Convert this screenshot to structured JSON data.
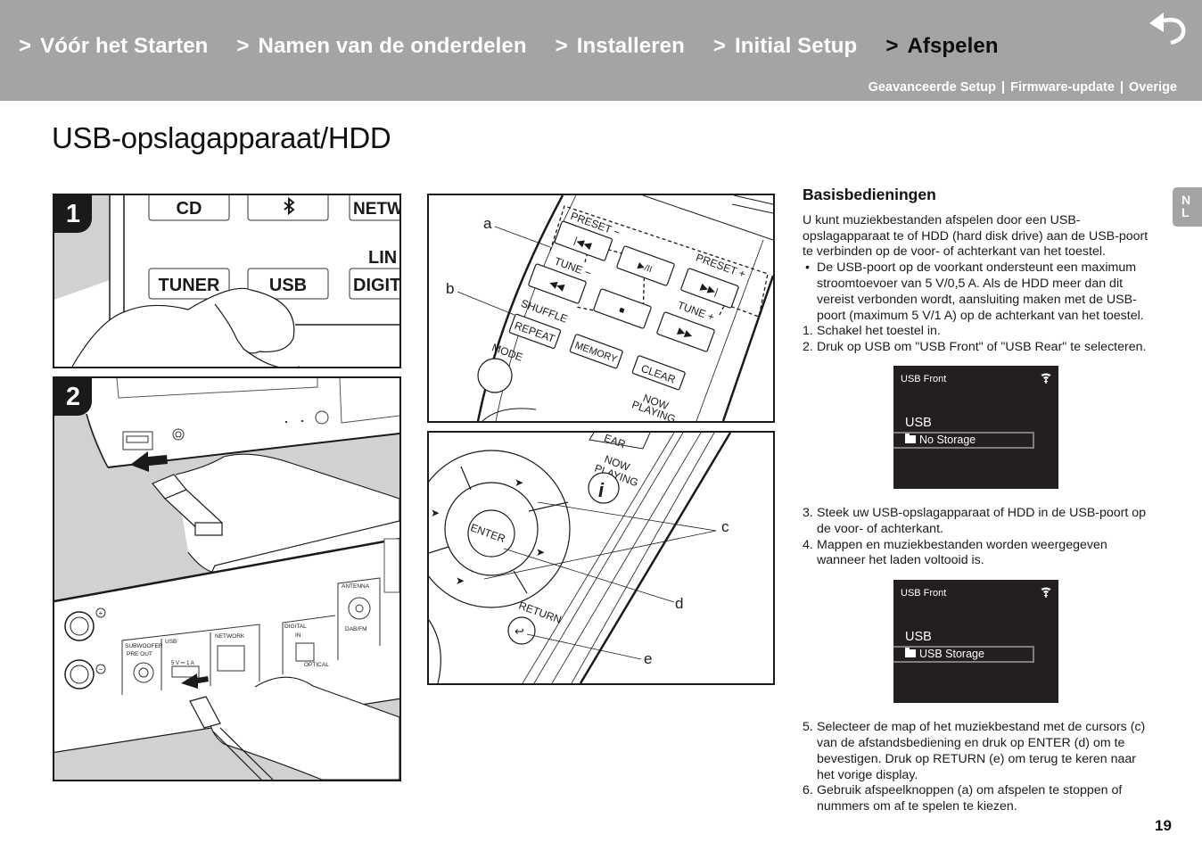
{
  "header": {
    "nav": [
      {
        "label": "Vóór het Starten",
        "active": false
      },
      {
        "label": "Namen van de onderdelen",
        "active": false
      },
      {
        "label": "Installeren",
        "active": false
      },
      {
        "label": "Initial Setup",
        "active": false
      },
      {
        "label": "Afspelen",
        "active": true
      }
    ],
    "chevron": ">",
    "back_icon": "return-arrow-icon",
    "subnav": [
      "Geavanceerde Setup",
      "Firmware-update",
      "Overige"
    ],
    "subnav_separator": "|",
    "colors": {
      "bar": "#a5a3a4",
      "text": "#ffffff",
      "active": "#0d0d0d"
    }
  },
  "page": {
    "title": "USB-opslagapparaat/HDD",
    "language_badge": [
      "N",
      "L"
    ],
    "page_number": "19"
  },
  "figures": {
    "panel1": {
      "step": "1",
      "buttons": [
        "CD",
        "NETWO",
        "TUNER",
        "USB",
        "DIGIT"
      ],
      "side_label": "LIN",
      "bluetooth_icon": "bluetooth-icon"
    },
    "panel2": {
      "step": "2",
      "rear_labels": {
        "subwoofer": "SUBWOOFER",
        "pre_out": "PRE OUT",
        "usb": "USB",
        "usb_rating": "5 V ⎓ 1 A",
        "network": "NETWORK",
        "digital": "DIGITAL",
        "in": "IN",
        "optical": "OPTICAL",
        "antenna": "ANTENNA",
        "dab_fm": "DAB/FM",
        "plus": "+",
        "minus": "−"
      }
    },
    "panel3": {
      "callouts": [
        "a",
        "b"
      ],
      "buttons": {
        "preset_minus": "PRESET −",
        "preset_plus": "PRESET +",
        "tune_minus": "TUNE −",
        "tune_plus": "TUNE +",
        "shuffle": "SHUFFLE",
        "repeat": "REPEAT",
        "memory": "MEMORY",
        "clear": "CLEAR",
        "mode": "MODE",
        "now": "NOW",
        "playing": "PLAYING"
      }
    },
    "panel4": {
      "callouts": [
        "c",
        "d",
        "e"
      ],
      "buttons": {
        "enter": "ENTER",
        "return": "RETURN",
        "now": "NOW",
        "playing": "PLAYING",
        "info": "i",
        "clear_partial": "EAR"
      }
    }
  },
  "content": {
    "heading": "Basisbedieningen",
    "intro": "U kunt muziekbestanden afspelen door een USB-opslagapparaat te of HDD (hard disk drive) aan de USB-poort te verbinden op de voor- of achterkant van het toestel.",
    "bullet": "De USB-poort op de voorkant ondersteunt een maximum stroomtoevoer van 5 V/0,5 A. Als de HDD meer dan dit vereist verbonden wordt, aansluiting maken met de USB-poort (maximum 5 V/1 A) op de achterkant van het toestel.",
    "steps": [
      {
        "num": "1.",
        "text": "Schakel het toestel in."
      },
      {
        "num": "2.",
        "text": "Druk op USB om \"USB Front\" of \"USB Rear\" te selecteren."
      },
      {
        "num": "3.",
        "text": "Steek uw USB-opslagapparaat of HDD in de USB-poort op de voor- of achterkant."
      },
      {
        "num": "4.",
        "text": "Mappen en muziekbestanden worden weergegeven wanneer het laden voltooid is."
      },
      {
        "num": "5.",
        "text": "Selecteer de map of het muziekbestand met de cursors (c) van de afstandsbediening en druk op ENTER (d) om te bevestigen. Druk op RETURN (e) om terug te keren naar het vorige display."
      },
      {
        "num": "6.",
        "text": "Gebruik afspeelknoppen (a) om afspelen te stoppen of nummers om af te spelen te kiezen."
      }
    ],
    "displays": [
      {
        "source": "USB Front",
        "title": "USB",
        "item": "No Storage",
        "icon": "wifi-icon"
      },
      {
        "source": "USB Front",
        "title": "USB",
        "item": "USB Storage",
        "icon": "wifi-icon"
      }
    ]
  }
}
